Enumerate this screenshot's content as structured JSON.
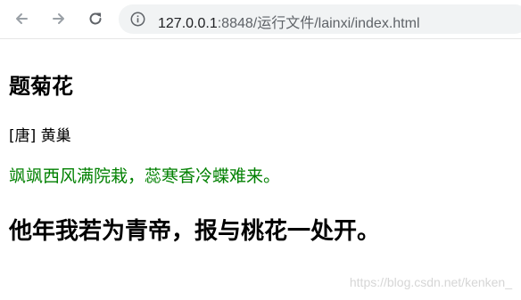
{
  "browser": {
    "url_host": "127.0.0.1",
    "url_rest": ":8848/运行文件/lainxi/index.html"
  },
  "poem": {
    "title": "题菊花",
    "author": "[唐] 黄巢",
    "line1": "飒飒西风满院栽，蕊寒香冷蝶难来。",
    "line2": "他年我若为青帝，报与桃花一处开。"
  },
  "watermark": "https://blog.csdn.net/kenken_",
  "colors": {
    "line1": "#008000",
    "toolbar_bg": "#ffffff",
    "omnibox_bg": "#f1f3f4"
  },
  "icons": {
    "back": "back-arrow-icon",
    "forward": "forward-arrow-icon",
    "reload": "reload-icon",
    "info": "info-icon"
  }
}
